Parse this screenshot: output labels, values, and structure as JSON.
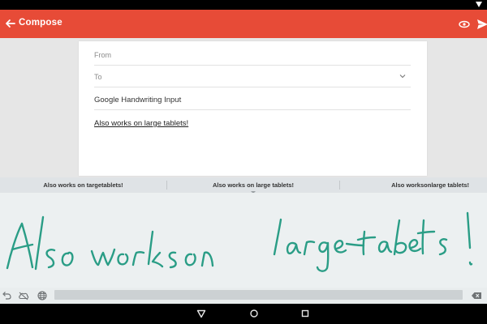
{
  "app_bar": {
    "title": "Compose"
  },
  "compose": {
    "from_placeholder": "From",
    "to_placeholder": "To",
    "subject": "Google Handwriting Input",
    "body": "Also works on large tablets!"
  },
  "suggestions": [
    "Also works on targetablets!",
    "Also works on large tablets!",
    "Also worksonlarge tablets!"
  ],
  "handwriting": {
    "ink_color": "#2a9d86"
  },
  "colors": {
    "app_bar": "#e74b37",
    "keyboard_bg": "#ecf0f1"
  },
  "icons": {
    "back": "arrow-left",
    "preview": "eye",
    "send": "paper-plane",
    "undo": "undo",
    "cloud": "cloud-off",
    "language": "globe",
    "delete": "backspace",
    "nav_back": "triangle",
    "nav_home": "circle",
    "nav_recents": "square"
  }
}
